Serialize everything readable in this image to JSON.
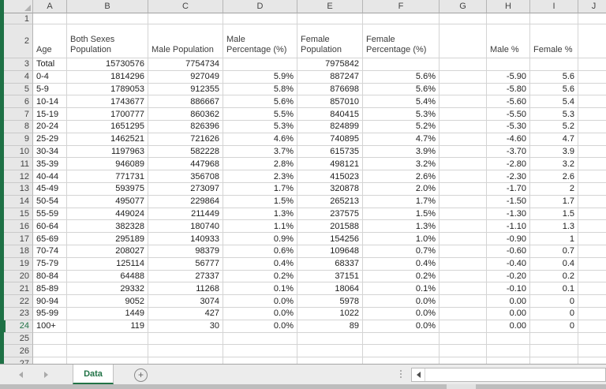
{
  "sheet": {
    "name": "Data",
    "column_letters": [
      "A",
      "B",
      "C",
      "D",
      "E",
      "F",
      "G",
      "H",
      "I",
      "J"
    ],
    "active_row": 24,
    "rows": [
      {
        "n": 1,
        "cells": [
          "",
          "",
          "",
          "",
          "",
          "",
          "",
          "",
          "",
          ""
        ]
      },
      {
        "n": 2,
        "type": "header",
        "cells": [
          "Age",
          "Both Sexes\nPopulation",
          "Male Population",
          "Male\nPercentage (%)",
          "Female\nPopulation",
          "Female\nPercentage (%)",
          "",
          "Male %",
          "Female %",
          ""
        ]
      },
      {
        "n": 3,
        "cells": [
          "Total",
          "15730576",
          "7754734",
          "",
          "7975842",
          "",
          "",
          "",
          "",
          ""
        ]
      },
      {
        "n": 4,
        "cells": [
          "0-4",
          "1814296",
          "927049",
          "5.9%",
          "887247",
          "5.6%",
          "",
          "-5.90",
          "5.6",
          ""
        ]
      },
      {
        "n": 5,
        "cells": [
          "5-9",
          "1789053",
          "912355",
          "5.8%",
          "876698",
          "5.6%",
          "",
          "-5.80",
          "5.6",
          ""
        ]
      },
      {
        "n": 6,
        "cells": [
          "10-14",
          "1743677",
          "886667",
          "5.6%",
          "857010",
          "5.4%",
          "",
          "-5.60",
          "5.4",
          ""
        ]
      },
      {
        "n": 7,
        "cells": [
          "15-19",
          "1700777",
          "860362",
          "5.5%",
          "840415",
          "5.3%",
          "",
          "-5.50",
          "5.3",
          ""
        ]
      },
      {
        "n": 8,
        "cells": [
          "20-24",
          "1651295",
          "826396",
          "5.3%",
          "824899",
          "5.2%",
          "",
          "-5.30",
          "5.2",
          ""
        ]
      },
      {
        "n": 9,
        "cells": [
          "25-29",
          "1462521",
          "721626",
          "4.6%",
          "740895",
          "4.7%",
          "",
          "-4.60",
          "4.7",
          ""
        ]
      },
      {
        "n": 10,
        "cells": [
          "30-34",
          "1197963",
          "582228",
          "3.7%",
          "615735",
          "3.9%",
          "",
          "-3.70",
          "3.9",
          ""
        ]
      },
      {
        "n": 11,
        "cells": [
          "35-39",
          "946089",
          "447968",
          "2.8%",
          "498121",
          "3.2%",
          "",
          "-2.80",
          "3.2",
          ""
        ]
      },
      {
        "n": 12,
        "cells": [
          "40-44",
          "771731",
          "356708",
          "2.3%",
          "415023",
          "2.6%",
          "",
          "-2.30",
          "2.6",
          ""
        ]
      },
      {
        "n": 13,
        "cells": [
          "45-49",
          "593975",
          "273097",
          "1.7%",
          "320878",
          "2.0%",
          "",
          "-1.70",
          "2",
          ""
        ]
      },
      {
        "n": 14,
        "cells": [
          "50-54",
          "495077",
          "229864",
          "1.5%",
          "265213",
          "1.7%",
          "",
          "-1.50",
          "1.7",
          ""
        ]
      },
      {
        "n": 15,
        "cells": [
          "55-59",
          "449024",
          "211449",
          "1.3%",
          "237575",
          "1.5%",
          "",
          "-1.30",
          "1.5",
          ""
        ]
      },
      {
        "n": 16,
        "cells": [
          "60-64",
          "382328",
          "180740",
          "1.1%",
          "201588",
          "1.3%",
          "",
          "-1.10",
          "1.3",
          ""
        ]
      },
      {
        "n": 17,
        "cells": [
          "65-69",
          "295189",
          "140933",
          "0.9%",
          "154256",
          "1.0%",
          "",
          "-0.90",
          "1",
          ""
        ]
      },
      {
        "n": 18,
        "cells": [
          "70-74",
          "208027",
          "98379",
          "0.6%",
          "109648",
          "0.7%",
          "",
          "-0.60",
          "0.7",
          ""
        ]
      },
      {
        "n": 19,
        "cells": [
          "75-79",
          "125114",
          "56777",
          "0.4%",
          "68337",
          "0.4%",
          "",
          "-0.40",
          "0.4",
          ""
        ]
      },
      {
        "n": 20,
        "cells": [
          "80-84",
          "64488",
          "27337",
          "0.2%",
          "37151",
          "0.2%",
          "",
          "-0.20",
          "0.2",
          ""
        ]
      },
      {
        "n": 21,
        "cells": [
          "85-89",
          "29332",
          "11268",
          "0.1%",
          "18064",
          "0.1%",
          "",
          "-0.10",
          "0.1",
          ""
        ]
      },
      {
        "n": 22,
        "cells": [
          "90-94",
          "9052",
          "3074",
          "0.0%",
          "5978",
          "0.0%",
          "",
          "0.00",
          "0",
          ""
        ]
      },
      {
        "n": 23,
        "cells": [
          "95-99",
          "1449",
          "427",
          "0.0%",
          "1022",
          "0.0%",
          "",
          "0.00",
          "0",
          ""
        ]
      },
      {
        "n": 24,
        "cells": [
          "100+",
          "119",
          "30",
          "0.0%",
          "89",
          "0.0%",
          "",
          "0.00",
          "0",
          ""
        ]
      },
      {
        "n": 25,
        "cells": [
          "",
          "",
          "",
          "",
          "",
          "",
          "",
          "",
          "",
          ""
        ]
      },
      {
        "n": 26,
        "cells": [
          "",
          "",
          "",
          "",
          "",
          "",
          "",
          "",
          "",
          ""
        ]
      },
      {
        "n": 27,
        "cells": [
          "",
          "",
          "",
          "",
          "",
          "",
          "",
          "",
          "",
          ""
        ]
      }
    ]
  },
  "tab_bar": {
    "active_tab": "Data",
    "add_sheet_label": "+"
  },
  "colors": {
    "excel_green": "#217346",
    "window_edge_green": "#1e7145",
    "header_bg": "#e7e7e7",
    "gridline": "#d4d4d4"
  }
}
